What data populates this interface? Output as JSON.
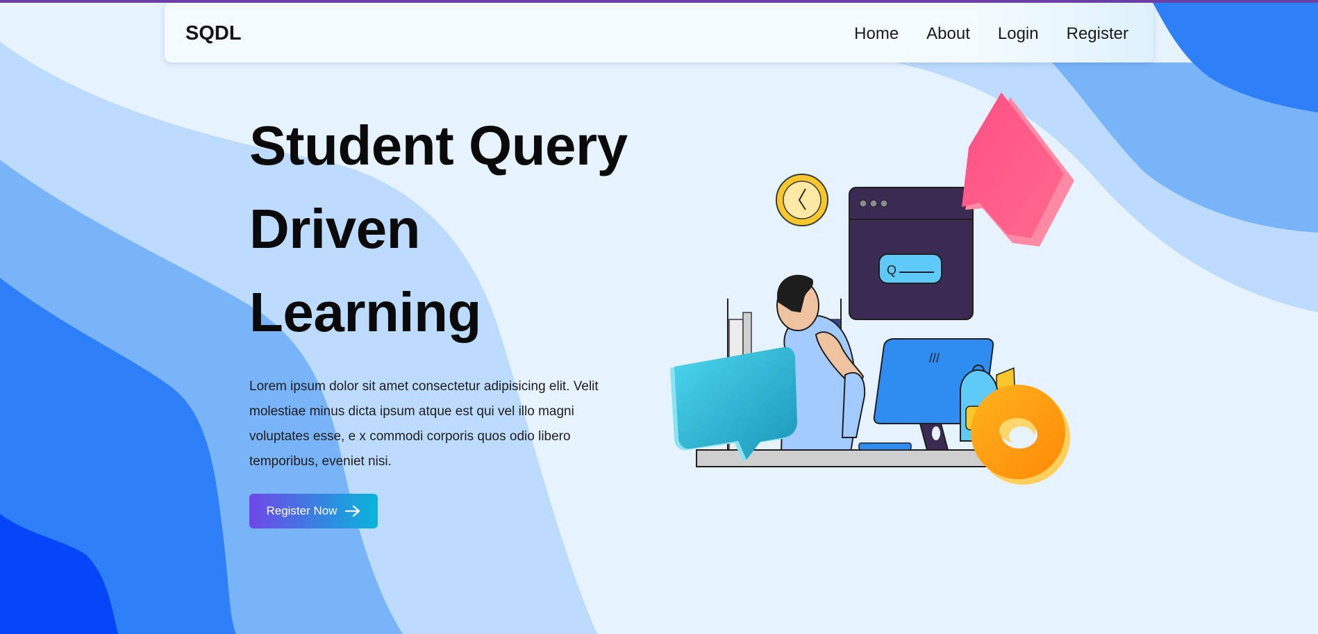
{
  "brand": {
    "name": "SQDL"
  },
  "nav": {
    "items": [
      "Home",
      "About",
      "Login",
      "Register"
    ]
  },
  "hero": {
    "title_lines": [
      "Student Query",
      "Driven",
      "Learning"
    ],
    "description": "Lorem ipsum dolor sit amet consectetur adipisicing elit. Velit molestiae minus dicta ipsum atque est qui vel illo magni voluptates esse, e x commodi corporis quos odio libero temporibus, eveniet nisi.",
    "cta_label": "Register Now"
  },
  "illustration": {
    "search_glyph": "Q",
    "screen_text": "///",
    "icons": [
      "clock-icon",
      "browser-window-icon",
      "search-bar-icon",
      "speech-bubble-icon",
      "monitor-icon",
      "backpack-icon",
      "donut-icon",
      "chat-bubble-icon"
    ]
  },
  "colors": {
    "topline": "#6b3fa8",
    "background": "#e6f2fe",
    "wave_light": "#bddbfc",
    "wave_mid": "#79b3f8",
    "wave_bright": "#2f80f8",
    "wave_deep": "#0547f8",
    "cta_start": "#7047e8",
    "cta_end": "#08b5db"
  }
}
